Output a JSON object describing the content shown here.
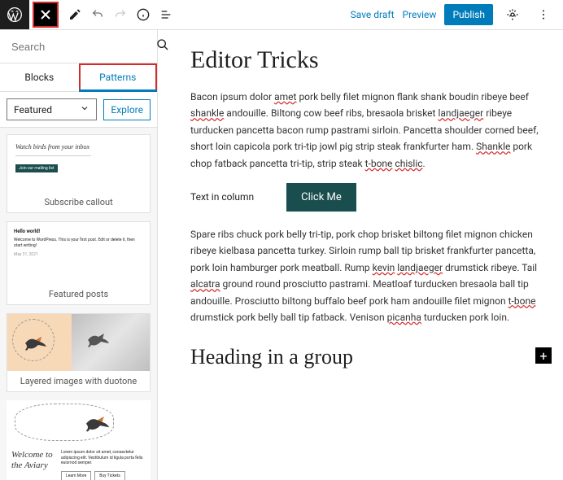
{
  "topbar": {
    "save": "Save draft",
    "preview": "Preview",
    "publish": "Publish"
  },
  "sidebar": {
    "search_placeholder": "Search",
    "tabs": {
      "blocks": "Blocks",
      "patterns": "Patterns"
    },
    "filter": "Featured",
    "explore": "Explore",
    "patterns": [
      {
        "label": "Subscribe callout",
        "title": "Watch birds from your inbox",
        "badge": "Join our mailing list"
      },
      {
        "label": "Featured posts",
        "heading": "Hello world!",
        "body": "Welcome to WordPress. This is your first post. Edit or delete it, then start writing!",
        "date": "May 31, 2021"
      },
      {
        "label": "Layered images with duotone"
      },
      {
        "label": "",
        "welcome": "Welcome to the Aviary",
        "lorem": "Lorem ipsum dolor sit amet, consectetur adipiscing elit. Vestibulum id ligula porta felis euismod semper.",
        "b1": "Learn More",
        "b2": "Buy Tickets"
      }
    ]
  },
  "doc": {
    "title": "Editor Tricks",
    "p1a": "Bacon ipsum dolor ",
    "p1_amet": "amet",
    "p1b": " pork belly filet mignon flank shank boudin ribeye beef ",
    "p1_shankle": "shankle",
    "p1c": " andouille. Biltong cow beef ribs, bresaola brisket ",
    "p1_land": "landjaeger",
    "p1d": " ribeye turducken pancetta bacon rump pastrami sirloin. Pancetta shoulder corned beef, short loin capicola pork tri-tip jowl pig strip steak frankfurter ham. ",
    "p1_shankle2": "Shankle",
    "p1e": " pork chop fatback pancetta tri-tip, strip steak ",
    "p1_tbone": "t-bone",
    "p1f": " ",
    "p1_chislic": "chislic",
    "p1g": ".",
    "col_text": "Text in column",
    "cta": "Click Me",
    "p2a": "Spare ribs chuck pork belly tri-tip, pork chop brisket biltong filet mignon chicken ribeye kielbasa pancetta turkey. Sirloin rump ball tip brisket frankfurter pancetta, pork loin hamburger pork meatball. Rump ",
    "p2_kevin": "kevin",
    "p2b": " ",
    "p2_land": "landjaeger",
    "p2c": " drumstick ribeye. Tail ",
    "p2_alcatra": "alcatra",
    "p2d": " ground round prosciutto pastrami. Meatloaf turducken bresaola ball tip andouille. Prosciutto biltong buffalo beef pork ham andouille filet mignon ",
    "p2_tbone": "t-bone",
    "p2e": " drumstick pork belly ball tip fatback. Venison ",
    "p2_picanha": "picanha",
    "p2f": " turducken pork loin.",
    "h2": "Heading in a group"
  }
}
